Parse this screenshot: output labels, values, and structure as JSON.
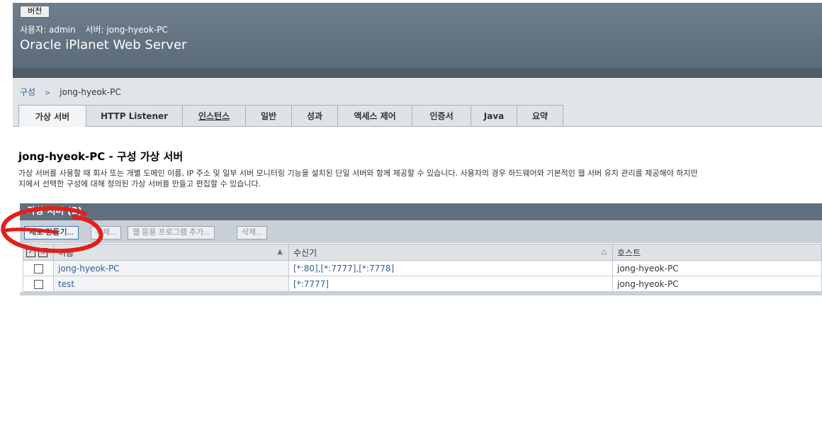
{
  "masthead": {
    "version_label": "버전",
    "user_label": "사용자: admin",
    "server_label": "서버: jong-hyeok-PC",
    "product_name": "Oracle iPlanet Web Server"
  },
  "breadcrumb": {
    "root": "구성",
    "separator": ">",
    "current": "jong-hyeok-PC"
  },
  "tabs": [
    {
      "label": "가상 서버"
    },
    {
      "label": "HTTP Listener"
    },
    {
      "label": "인스턴스"
    },
    {
      "label": "일반"
    },
    {
      "label": "성과"
    },
    {
      "label": "액세스 제어"
    },
    {
      "label": "인증서"
    },
    {
      "label": "Java"
    },
    {
      "label": "요약"
    }
  ],
  "content": {
    "title": "jong-hyeok-PC - 구성 가상 서버",
    "help_line1": "가상 서버를 사용할 때 회사 또는 개별 도메인 이름, IP 주소 및 일부 서버 모니터링 기능을 설치된 단일 서버와 함께 제공할 수 있습니다. 사용자의 경우 하드웨어와 기본적인 웹 서버 유지 관리를 제공해야 하지만",
    "help_line2": "지에서 선택한 구성에 대해 정의된 가상 서버를 만들고 편집할 수 있습니다."
  },
  "table_block": {
    "title": "가상 서버 (2)",
    "buttons": {
      "new": "새로 만들기...",
      "copy": "복제...",
      "add_webapp": "웹 응용 프로그램 추가...",
      "delete": "삭제..."
    },
    "columns": {
      "name": "이름",
      "listener": "수신기",
      "host": "호스트"
    },
    "rows": [
      {
        "name": "jong-hyeok-PC",
        "listener": "[*:80],[*:7777],[*:7778]",
        "host": "jong-hyeok-PC"
      },
      {
        "name": "test",
        "listener": "[*:7777]",
        "host": "jong-hyeok-PC"
      }
    ]
  },
  "colors": {
    "masthead": "#5a6a79",
    "link": "#2f5f98",
    "annotation": "#e0201c"
  }
}
